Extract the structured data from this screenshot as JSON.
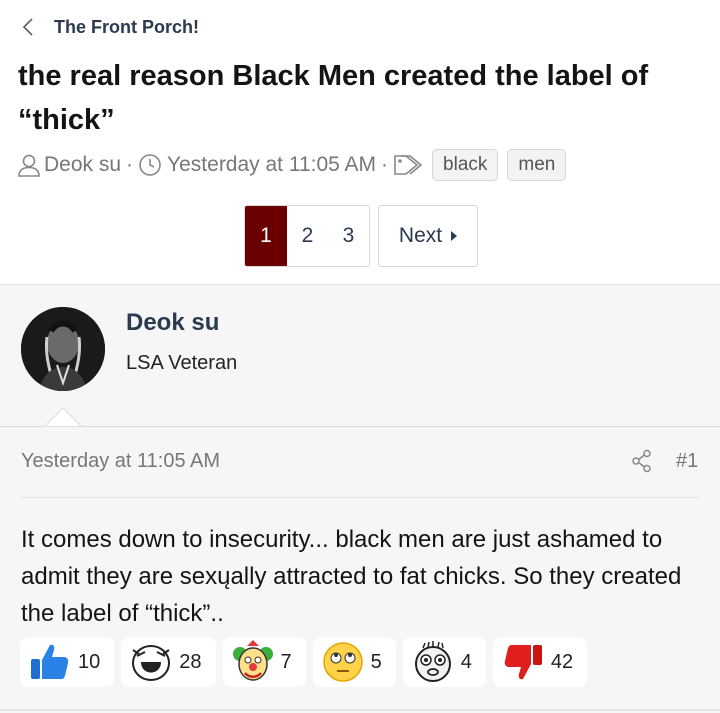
{
  "breadcrumb": {
    "label": "The Front Porch!"
  },
  "thread": {
    "title": "the real reason Black Men created the label of “thick”",
    "author": "Deok su",
    "separator": "·",
    "date": "Yesterday at 11:05 AM",
    "tags": [
      "black",
      "men"
    ]
  },
  "pagination": {
    "pages": [
      "1",
      "2",
      "3"
    ],
    "current": "1",
    "next_label": "Next"
  },
  "post": {
    "author_name": "Deok su",
    "author_title": "LSA Veteran",
    "date": "Yesterday at 11:05 AM",
    "number": "#1",
    "body": "It comes down to insecurity... black men are just ashamed to admit they are sexųally attracted to fat chicks. So they created the label of “thick”..",
    "reactions": [
      {
        "icon": "thumbs-up-icon",
        "count": "10"
      },
      {
        "icon": "laughing-face-icon",
        "count": "28"
      },
      {
        "icon": "clown-face-icon",
        "count": "7"
      },
      {
        "icon": "eye-roll-face-icon",
        "count": "5"
      },
      {
        "icon": "crazy-face-icon",
        "count": "4"
      },
      {
        "icon": "thumbs-down-icon",
        "count": "42"
      }
    ]
  },
  "colors": {
    "accent": "#6b0000",
    "link": "#2a3a4f",
    "muted": "#777777",
    "post_bg": "#f6f6f6"
  }
}
